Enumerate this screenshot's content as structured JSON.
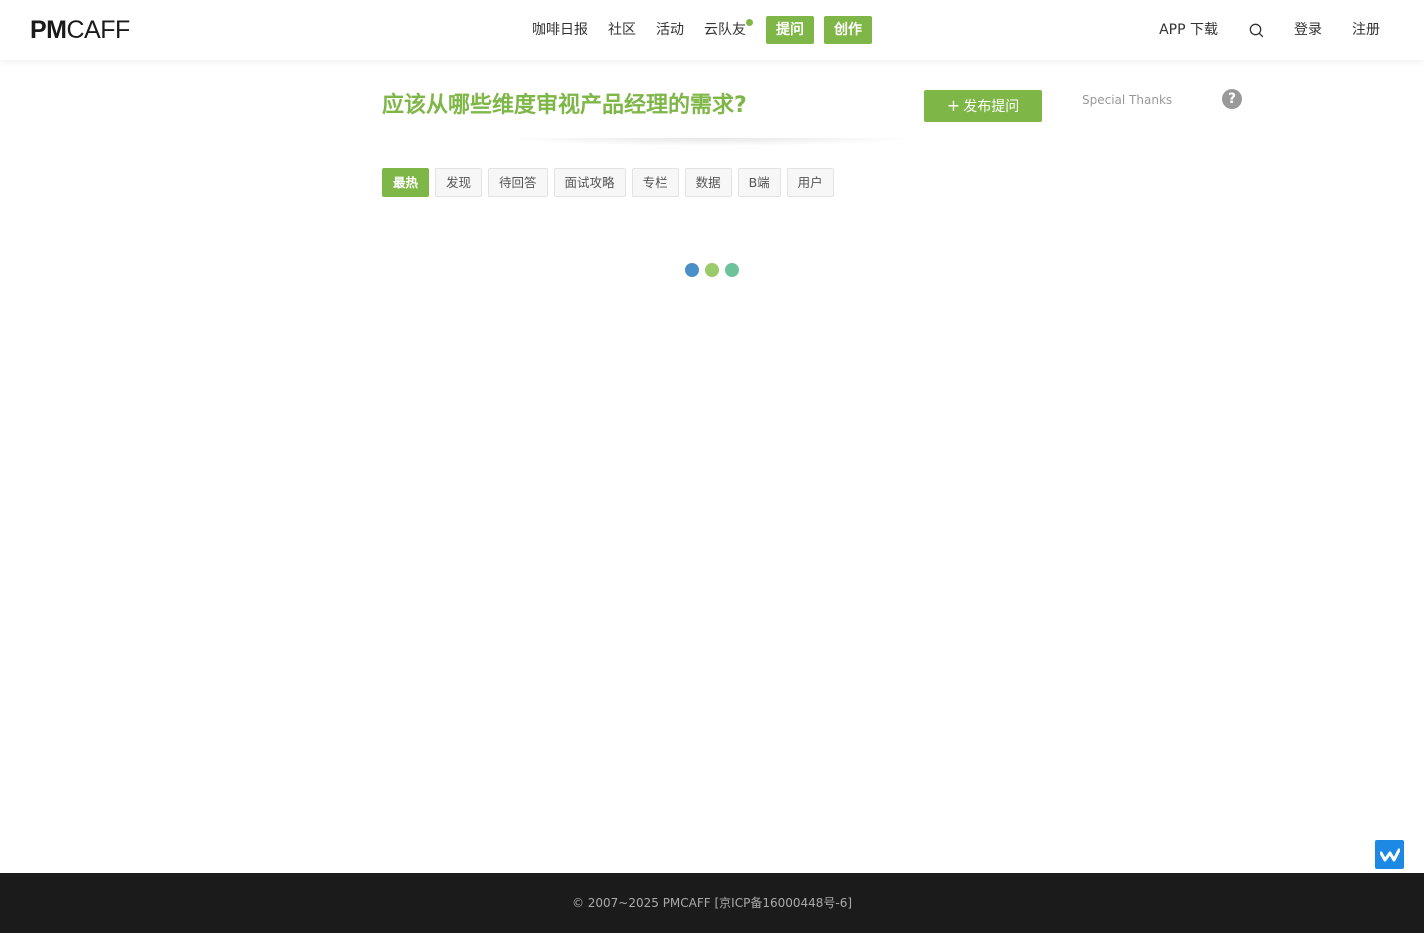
{
  "header": {
    "logo_pm": "PM",
    "logo_caff": "CAFF",
    "nav": [
      {
        "label": "咖啡日报"
      },
      {
        "label": "社区"
      },
      {
        "label": "活动"
      },
      {
        "label": "云队友"
      }
    ],
    "ask_button": "提问",
    "create_button": "创作",
    "app_download": "APP 下载",
    "login": "登录",
    "register": "注册"
  },
  "main": {
    "question_title": "应该从哪些维度审视产品经理的需求?",
    "publish_button": "发布提问",
    "special_thanks": "Special Thanks",
    "help_icon": "?",
    "tabs": [
      {
        "label": "最热",
        "active": true
      },
      {
        "label": "发现"
      },
      {
        "label": "待回答"
      },
      {
        "label": "面试攻略"
      },
      {
        "label": "专栏"
      },
      {
        "label": "数据"
      },
      {
        "label": "B端"
      },
      {
        "label": "用户"
      }
    ],
    "loader_colors": [
      "#4a90c8",
      "#9acb6a",
      "#6cc39a"
    ]
  },
  "colors": {
    "accent": "#7fb648",
    "footer_bg": "#1b1b1b",
    "float_icon_bg": "#1e88e5"
  },
  "icons": {
    "search": "search-icon",
    "help": "question-circle-icon",
    "float": "feedback-logo-icon",
    "plus": "plus-icon"
  },
  "footer": {
    "copyright": "© 2007~2025 PMCAFF [京ICP备16000448号-6]"
  }
}
